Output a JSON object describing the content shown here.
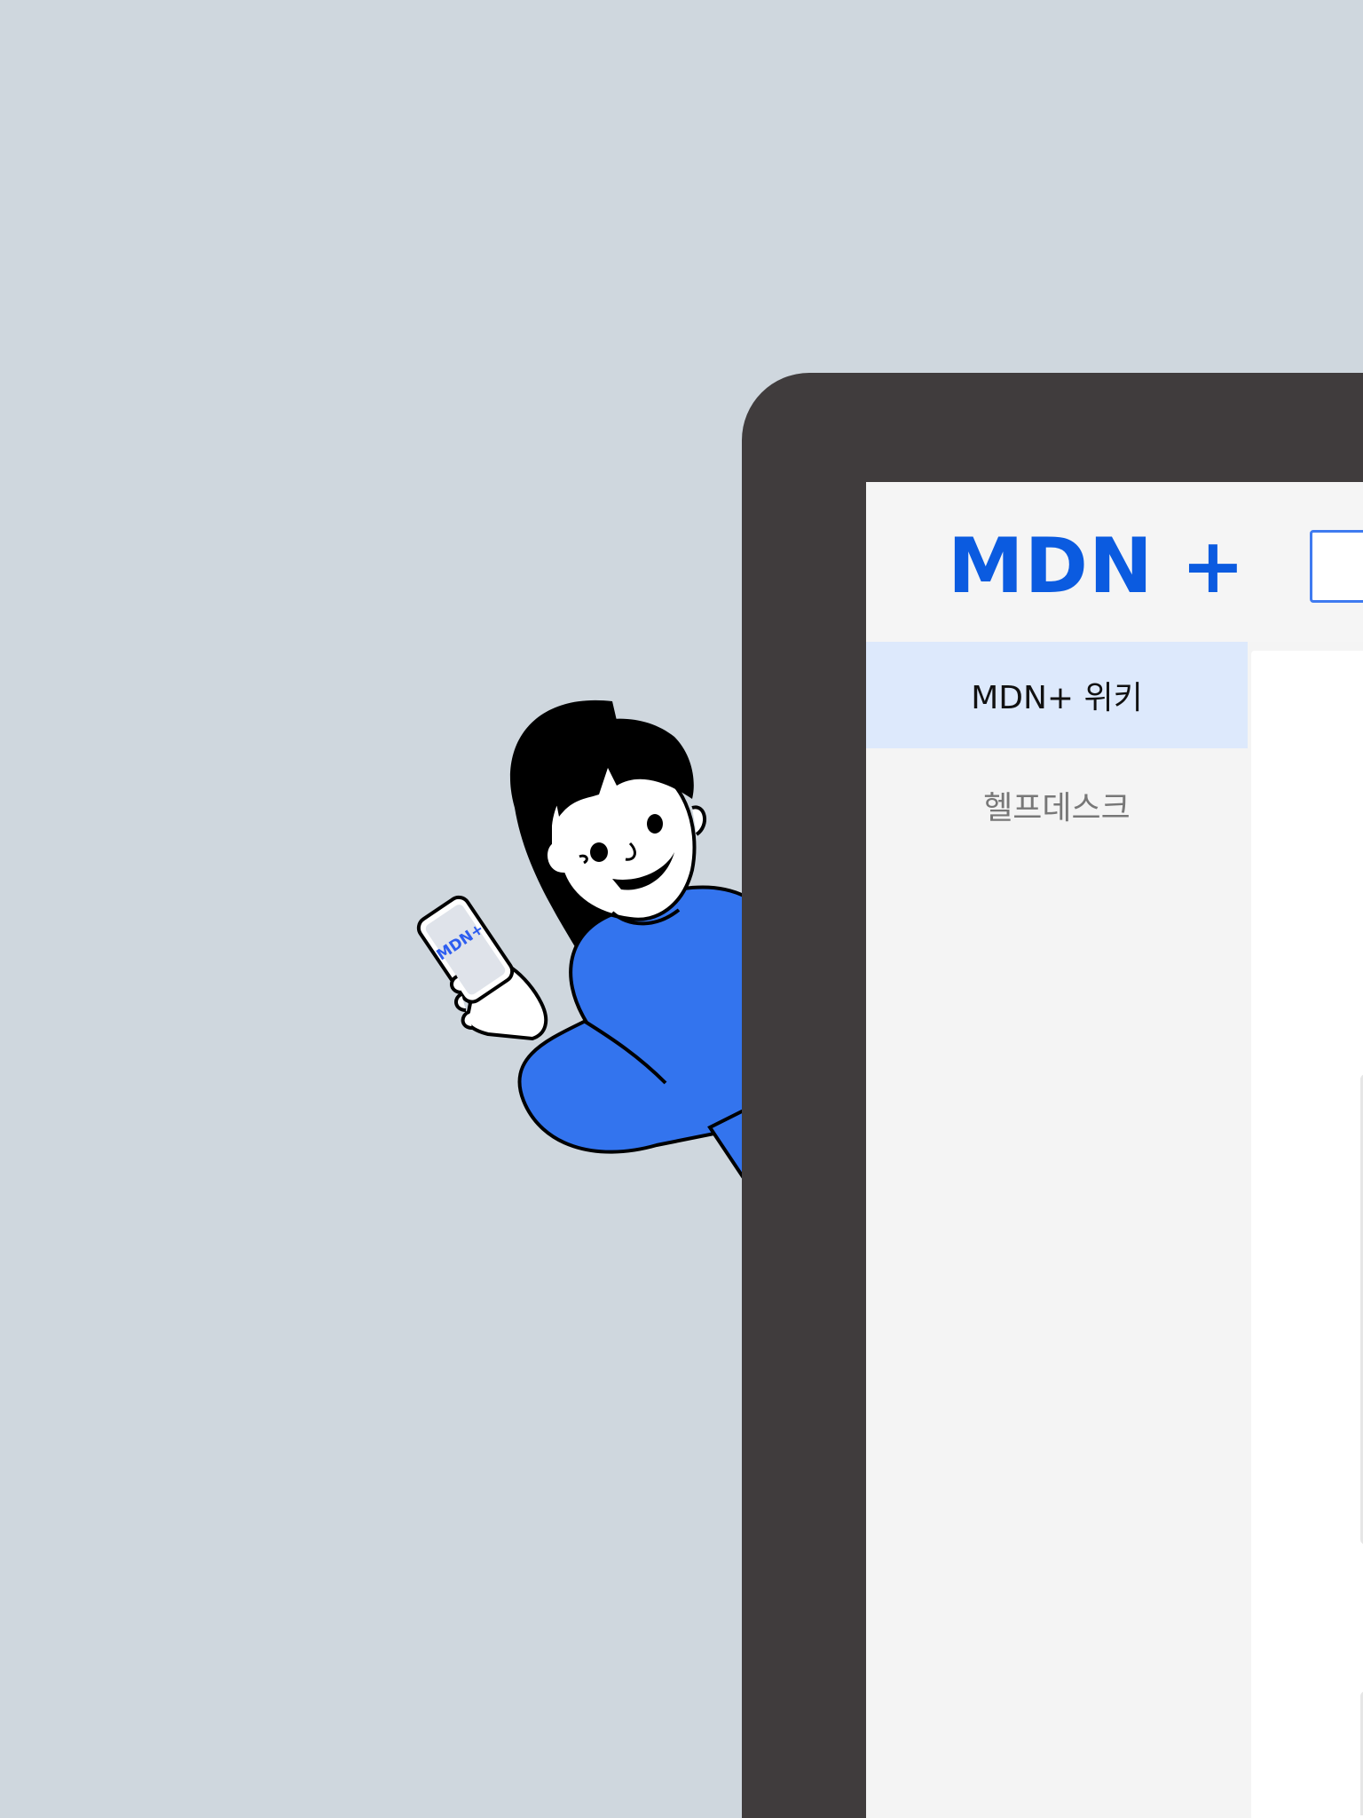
{
  "app": {
    "logo_text": "MDN +",
    "brand_color": "#0b5be0"
  },
  "sidebar": {
    "items": [
      {
        "label": "MDN+ 위키",
        "active": true
      },
      {
        "label": "헬프데스크",
        "active": false
      }
    ]
  },
  "illustration": {
    "phone_screen_text": "MDN+",
    "shirt_color": "#3374ee"
  },
  "colors": {
    "background": "#cfd7de",
    "bezel": "#403c3d",
    "active_nav": "#dde9fc",
    "search_border": "#3f7bf0"
  }
}
